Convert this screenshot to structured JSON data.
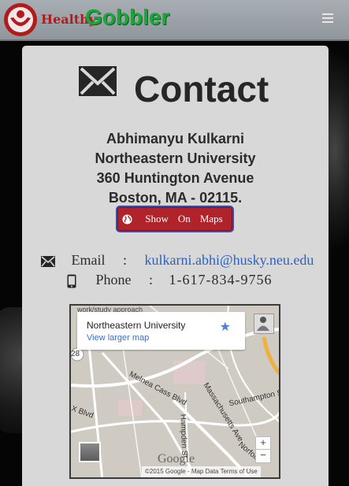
{
  "brand": {
    "healthy": "Healthy",
    "gobbler": "Gobbler"
  },
  "page": {
    "title": "Contact"
  },
  "address": {
    "name": "Abhimanyu Kulkarni",
    "org": "Northeastern University",
    "street": "360 Huntington Avenue",
    "city": "Boston, MA - 02115."
  },
  "maps_button": {
    "w1": "Show",
    "w2": "On",
    "w3": "Maps"
  },
  "email": {
    "label": "Email",
    "sep": ":",
    "value": "kulkarni.abhi@husky.neu.edu"
  },
  "phone": {
    "label": "Phone",
    "sep": ":",
    "value": "1-617-834-9756"
  },
  "map": {
    "top_text": "work/study approach",
    "place_name": "Northeastern University",
    "larger_map": "View larger map",
    "zoom_in": "+",
    "zoom_out": "−",
    "google": "Google",
    "footer": "©2015 Google - Map Data    Terms of Use",
    "streets": {
      "melnea": "Melnea Cass Blvd",
      "mass": "Massachusetts Ave",
      "southampton": "Southampton St",
      "hampden": "Hampden St",
      "norfolk": "Norfolk",
      "xblvd": "X Blvd",
      "route28": "28"
    }
  },
  "colors": {
    "brand_red": "#b01c1c",
    "brand_green": "#1fa43c",
    "button_red": "#b0232b",
    "link_blue": "#2962c6"
  }
}
